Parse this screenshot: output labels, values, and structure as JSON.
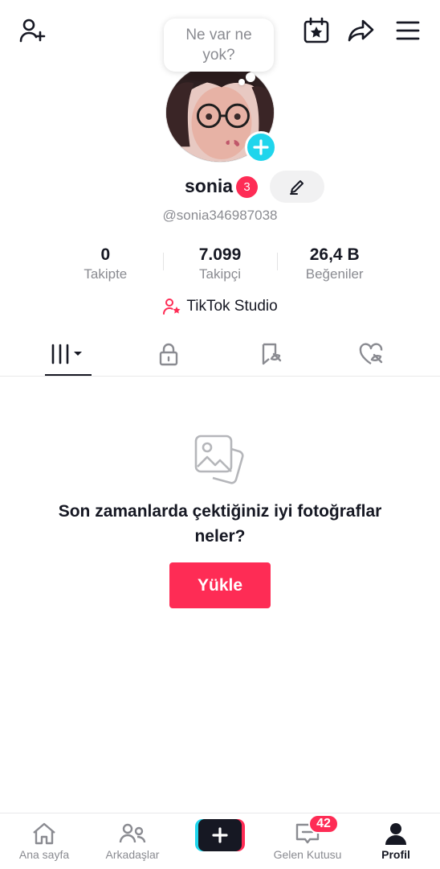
{
  "header": {
    "add_friend_icon": "person-add-icon",
    "calendar_icon": "calendar-star-icon",
    "share_icon": "share-arrow-icon",
    "menu_icon": "hamburger-menu-icon"
  },
  "profile": {
    "bubble_text": "Ne var ne yok?",
    "username": "sonia",
    "notification_count": "3",
    "handle": "@sonia346987038"
  },
  "stats": [
    {
      "value": "0",
      "label": "Takipte"
    },
    {
      "value": "7.099",
      "label": "Takipçi"
    },
    {
      "value": "26,4 B",
      "label": "Beğeniler"
    }
  ],
  "studio": {
    "label": "TikTok Studio"
  },
  "tabs": [
    {
      "name": "videos",
      "icon": "grid-icon",
      "active": true
    },
    {
      "name": "private",
      "icon": "lock-icon"
    },
    {
      "name": "saved",
      "icon": "bookmark-icon"
    },
    {
      "name": "liked",
      "icon": "heart-icon"
    }
  ],
  "empty_state": {
    "icon": "photo-icon",
    "message": "Son zamanlarda çektiğiniz iyi fotoğraflar neler?",
    "button_label": "Yükle"
  },
  "bottom_nav": {
    "home": "Ana sayfa",
    "friends": "Arkadaşlar",
    "inbox": "Gelen Kutusu",
    "inbox_count": "42",
    "profile": "Profil"
  },
  "colors": {
    "accent": "#fe2c55",
    "cyan": "#20d5ec",
    "text": "#161823",
    "muted": "#8a8b91"
  }
}
